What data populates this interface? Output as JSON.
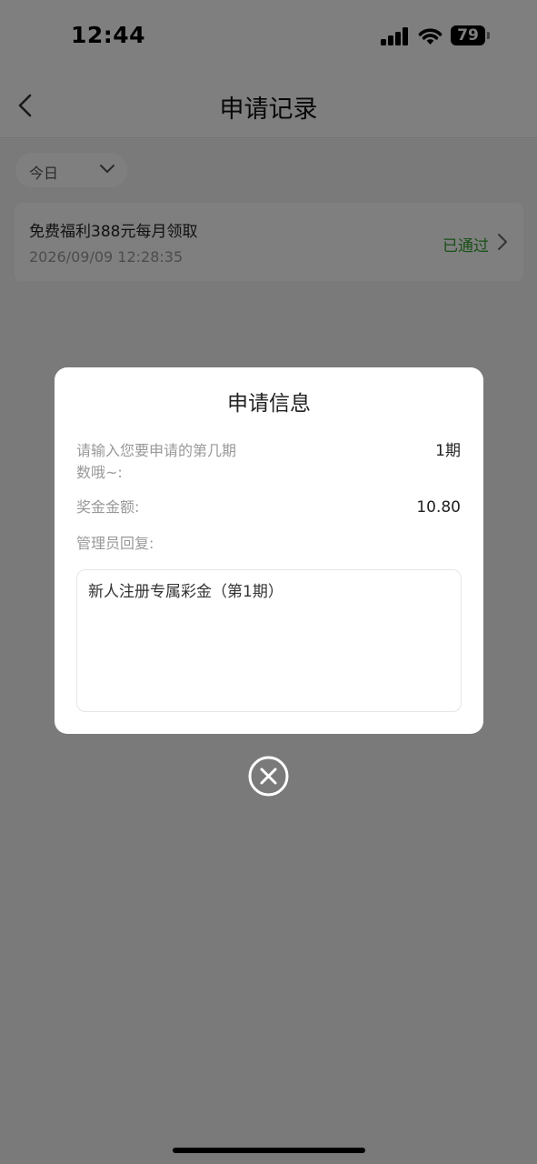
{
  "status_bar": {
    "time": "12:44",
    "battery": "79"
  },
  "nav": {
    "title": "申请记录"
  },
  "filter": {
    "label": "今日"
  },
  "record": {
    "title": "免费福利388元每月领取",
    "datetime": "2026/09/09 12:28:35",
    "status": "已通过",
    "status_color": "#2ea12e"
  },
  "modal": {
    "title": "申请信息",
    "fields": [
      {
        "label_line1": "请输入您要申请的第几期",
        "label_line2": "数哦~:",
        "value": "1期"
      },
      {
        "label": "奖金金额:",
        "value": "10.80"
      },
      {
        "label": "管理员回复:"
      }
    ],
    "reply": "新人注册专属彩金（第1期）"
  }
}
